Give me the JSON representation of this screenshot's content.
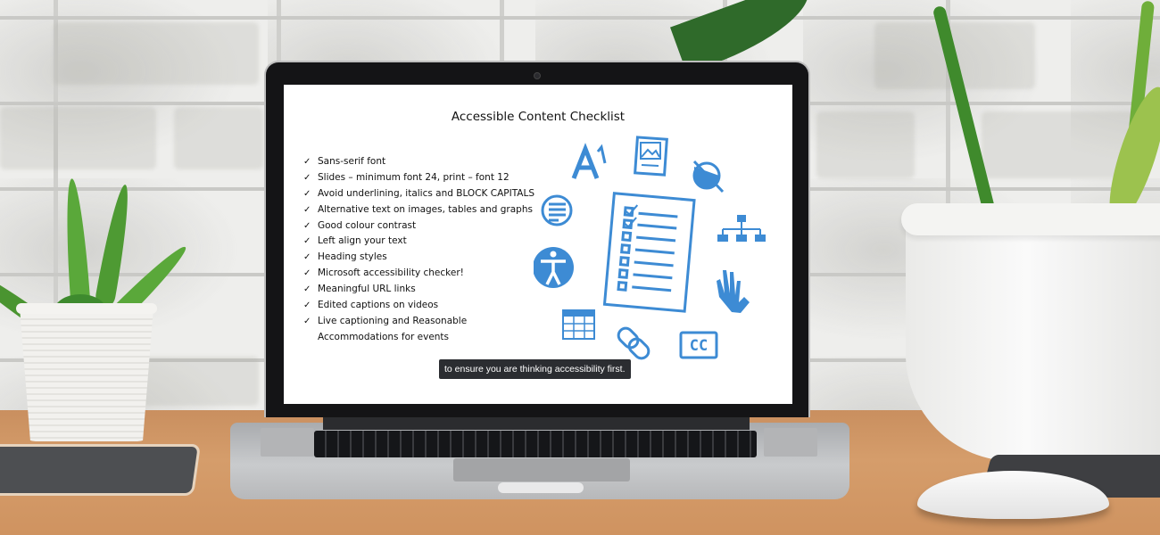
{
  "scene": {
    "description": "Laptop on wooden desk in front of white brick wall displaying a slide",
    "colors": {
      "icon_blue": "#3d8bd4",
      "caption_bg": "#2b2d31",
      "slide_bg": "#ffffff",
      "desk": "#d59d6b",
      "wall": "#eeeeec"
    }
  },
  "slide": {
    "title": "Accessible Content Checklist",
    "check_mark": "✓",
    "items": [
      {
        "text": "Sans-serif font"
      },
      {
        "text": "Slides – minimum font 24, print – font 12"
      },
      {
        "text": "Avoid underlining, italics and BLOCK CAPITALS"
      },
      {
        "text": "Alternative text on images, tables and graphs"
      },
      {
        "text": "Good colour contrast"
      },
      {
        "text": "Left align your text"
      },
      {
        "text": "Heading styles"
      },
      {
        "text": "Microsoft accessibility checker!"
      },
      {
        "text": "Meaningful URL links"
      },
      {
        "text": "Edited captions on videos"
      },
      {
        "text": "Live captioning and Reasonable"
      }
    ],
    "continuation": "Accommodations for events",
    "caption": "to ensure you are thinking accessibility first.",
    "icons": [
      "font-size-icon",
      "image-document-icon",
      "contrast-icon",
      "text-align-icon",
      "checklist-icon",
      "hierarchy-icon",
      "accessibility-person-icon",
      "sign-language-hand-icon",
      "table-icon",
      "link-icon",
      "closed-captions-icon"
    ],
    "cc_label": "CC",
    "font_icon_label": "A"
  }
}
